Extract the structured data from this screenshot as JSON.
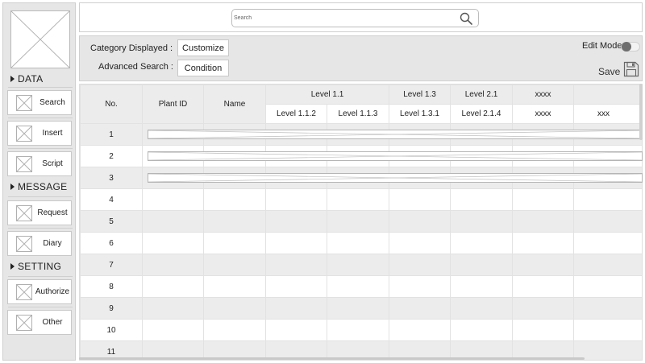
{
  "sidebar": {
    "sections": [
      {
        "label": "DATA",
        "items": [
          {
            "label": "Search"
          },
          {
            "label": "Insert"
          },
          {
            "label": "Script"
          }
        ]
      },
      {
        "label": "MESSAGE",
        "items": [
          {
            "label": "Request"
          },
          {
            "label": "Diary"
          }
        ]
      },
      {
        "label": "SETTING",
        "items": [
          {
            "label": "Authorize"
          },
          {
            "label": "Other"
          }
        ]
      }
    ]
  },
  "search": {
    "placeholder": "Search",
    "value": ""
  },
  "filter": {
    "category_label": "Category Displayed :",
    "category_button": "Customize",
    "advanced_label": "Advanced Search :",
    "advanced_button": "Condition",
    "edit_mode_label": "Edit Mode",
    "edit_mode_on": false,
    "save_label": "Save"
  },
  "table": {
    "headers": {
      "no": "No.",
      "plant_id": "Plant ID",
      "name": "Name",
      "group_level_1_1": "Level 1.1",
      "level_1_1_2": "Level 1.1.2",
      "level_1_1_3": "Level 1.1.3",
      "group_level_1_3": "Level 1.3",
      "level_1_3_1": "Level 1.3.1",
      "group_level_2_1": "Level 2.1",
      "level_2_1_4": "Level 2.1.4",
      "group_xxxx": "xxxx",
      "sub_xxxx": "xxxx",
      "group_xxx_partial": "xxx",
      "sub_xxx": "xxx"
    },
    "row_numbers": [
      "1",
      "2",
      "3",
      "4",
      "5",
      "6",
      "7",
      "8",
      "9",
      "10",
      "11"
    ]
  },
  "icons": {
    "search": "search-icon",
    "save": "save-icon",
    "placeholder": "image-placeholder-icon",
    "section_arrow": "triangle-right-icon"
  },
  "colors": {
    "panel": "#e6e6e6",
    "border": "#cfcfcf",
    "toggle_knob": "#6e6e6e"
  }
}
